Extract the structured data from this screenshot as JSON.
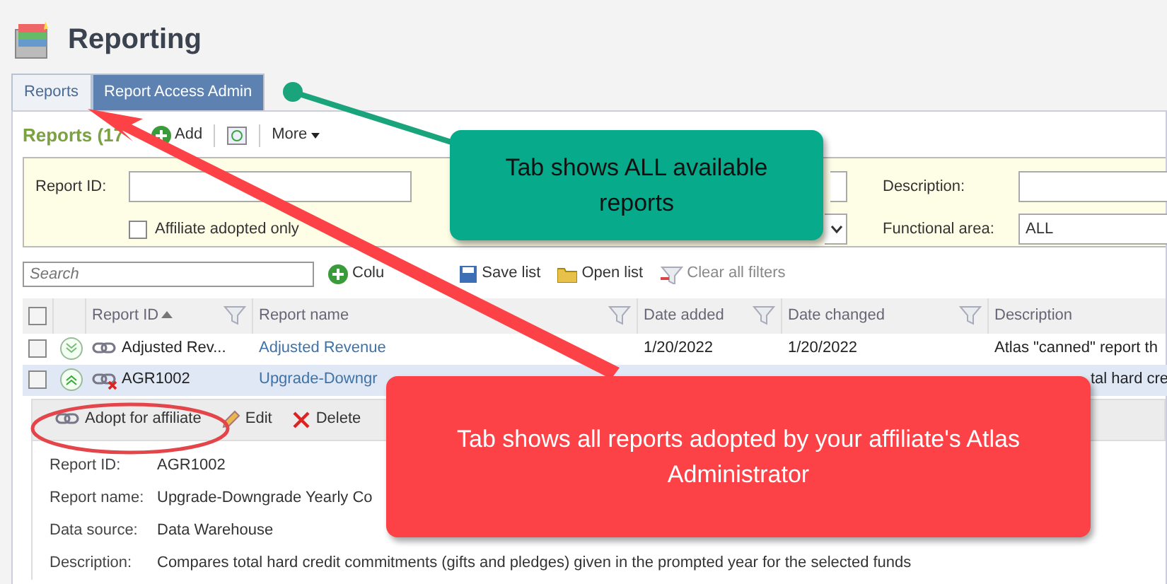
{
  "header": {
    "title": "Reporting"
  },
  "tabs": [
    {
      "label": "Reports",
      "selected": true
    },
    {
      "label": "Report Access Admin",
      "selected": false
    }
  ],
  "list_toolbar": {
    "title": "Reports (17",
    "add": "Add",
    "more": "More"
  },
  "filters": {
    "report_id_label": "Report ID:",
    "affiliate_only": {
      "label": "Affiliate adopted only",
      "checked": false
    },
    "description_label": "Description:",
    "functional_area_label": "Functional area:",
    "functional_area_value": "ALL"
  },
  "grid_toolbar": {
    "search_placeholder": "Search",
    "columns": "Colu",
    "save": "Save list",
    "open": "Open list",
    "clear": "Clear all filters"
  },
  "table": {
    "select_all": {
      "checked": false
    },
    "columns": [
      {
        "label": "Report ID",
        "sorted": true,
        "filter": true
      },
      {
        "label": "Report name",
        "sorted": false,
        "filter": true
      },
      {
        "label": "Date added",
        "sorted": false,
        "filter": true
      },
      {
        "label": "Date changed",
        "sorted": false,
        "filter": true
      },
      {
        "label": "Description",
        "sorted": false,
        "filter": false
      }
    ],
    "rows": [
      {
        "checked": false,
        "expanded": false,
        "selected": false,
        "adopted": true,
        "cells": [
          "Adjusted Rev...",
          "Adjusted Revenue",
          "1/20/2022",
          "1/20/2022",
          "Atlas \"canned\" report th"
        ]
      },
      {
        "checked": false,
        "expanded": true,
        "selected": true,
        "adopted": false,
        "cells": [
          "AGR1002",
          "Upgrade-Downgr",
          "",
          "",
          "tal hard cre"
        ]
      }
    ]
  },
  "detail": {
    "actions": [
      {
        "kind": "adopt",
        "label": "Adopt for affiliate"
      },
      {
        "kind": "edit",
        "label": "Edit"
      },
      {
        "kind": "delete",
        "label": "Delete"
      }
    ],
    "fields": [
      {
        "label": "Report ID:",
        "value": "AGR1002"
      },
      {
        "label": "Report name:",
        "value": "Upgrade-Downgrade Yearly Co"
      },
      {
        "label": "Data source:",
        "value": "Data Warehouse"
      },
      {
        "label": "Description:",
        "value": "Compares total hard credit commitments (gifts and pledges) given in the prompted year for the selected funds"
      }
    ]
  },
  "callouts": [
    {
      "kind": "green",
      "text": "Tab shows ALL available reports"
    },
    {
      "kind": "red",
      "text": "Tab shows all reports adopted by your affiliate's Atlas Administrator"
    }
  ]
}
